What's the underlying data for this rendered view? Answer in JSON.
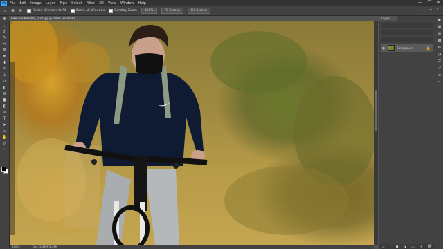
{
  "menubar": {
    "logo": "Ps",
    "items": [
      "File",
      "Edit",
      "Image",
      "Layer",
      "Type",
      "Select",
      "Filter",
      "3D",
      "View",
      "Window",
      "Help"
    ]
  },
  "window_controls": [
    "—",
    "❐",
    "✕"
  ],
  "options": {
    "resize_windows_label": "Resize Windows to Fit",
    "zoom_all_label": "Zoom All Windows",
    "scrubby_zoom_label": "Scrubby Zoom",
    "zoom_percent": "100%",
    "fit_screen": "Fit Screen",
    "fill_screen": "Fill Screen"
  },
  "document": {
    "tab_title": "bike ride-889395_1920.jpg @ 200% (RGB/8#)",
    "zoom": "200%",
    "doc_info": "Doc: 5.49M/5.49M"
  },
  "layers_panel": {
    "tab": "Layers",
    "layer_name": "Background",
    "accent": "#31a8ff"
  },
  "icons": {
    "tools": [
      "move-icon",
      "marquee-icon",
      "lasso-icon",
      "quick-select-icon",
      "crop-icon",
      "frame-icon",
      "eyedropper-icon",
      "healing-icon",
      "brush-icon",
      "stamp-icon",
      "history-brush-icon",
      "eraser-icon",
      "gradient-icon",
      "blur-icon",
      "dodge-icon",
      "pen-icon",
      "type-icon",
      "path-select-icon",
      "shape-icon",
      "hand-icon",
      "zoom-icon",
      "more-icon"
    ]
  }
}
